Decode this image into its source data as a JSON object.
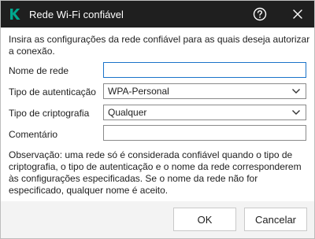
{
  "window": {
    "title": "Rede Wi-Fi confiável",
    "logo_icon": "kaspersky-k-logo",
    "help_icon": "help-icon",
    "close_icon": "close-icon",
    "accent_color": "#00a88e"
  },
  "intro_text": "Insira as configurações da rede confiável para as quais deseja autorizar a conexão.",
  "form": {
    "network_name": {
      "label": "Nome de rede",
      "value": ""
    },
    "auth_type": {
      "label": "Tipo de autenticação",
      "value": "WPA-Personal"
    },
    "encryption_type": {
      "label": "Tipo de criptografia",
      "value": "Qualquer"
    },
    "comment": {
      "label": "Comentário",
      "value": ""
    }
  },
  "note_text": "Observação: uma rede só é considerada confiável quando o tipo de criptografia, o tipo de autenticação e o nome da rede corresponderem às configurações especificadas. Se o nome da rede não for especificado, qualquer nome é aceito.",
  "buttons": {
    "ok_label": "OK",
    "cancel_label": "Cancelar"
  }
}
